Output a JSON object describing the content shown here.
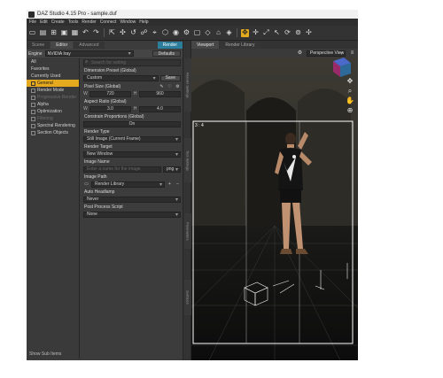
{
  "window": {
    "title": "DAZ Studio 4.15 Pro - sample.duf"
  },
  "menu": [
    "File",
    "Edit",
    "Create",
    "Tools",
    "Render",
    "Connect",
    "Window",
    "Help"
  ],
  "left_tabs": [
    {
      "label": "Scene",
      "active": false
    },
    {
      "label": "Editor",
      "active": true
    },
    {
      "label": "Advanced",
      "active": false
    },
    {
      "label": "Render",
      "active": false
    }
  ],
  "engine": {
    "label": "Engine",
    "value": "NVIDIA Iray",
    "defaults_label": "Defaults"
  },
  "categories": [
    {
      "label": "All"
    },
    {
      "label": "Favorites"
    },
    {
      "label": "Currently Used"
    },
    {
      "label": "General",
      "selected": true
    },
    {
      "label": "Render Mode"
    },
    {
      "label": "Progressive Render",
      "dim": true
    },
    {
      "label": "Alpha"
    },
    {
      "label": "Optimization"
    },
    {
      "label": "Filtering",
      "dim": true
    },
    {
      "label": "Spectral Rendering"
    },
    {
      "label": "Section Objects"
    }
  ],
  "show_sub_items": "Show Sub Items",
  "settings": {
    "search_placeholder": "Search for setting",
    "dimension_preset": {
      "title": "Dimension Preset (Global)",
      "value": "Custom",
      "save_label": "Save"
    },
    "pixel_size": {
      "title": "Pixel Size (Global)",
      "w_label": "W",
      "w": "720",
      "h_label": "H",
      "h": "960"
    },
    "aspect_ratio": {
      "title": "Aspect Ratio (Global)",
      "w_label": "W",
      "w": "3.0",
      "h_label": "H",
      "h": "4.0"
    },
    "constrain": {
      "title": "Constrain Proportions (Global)",
      "value": "On"
    },
    "render_type": {
      "title": "Render Type",
      "value": "Still Image (Current Frame)"
    },
    "render_target": {
      "title": "Render Target",
      "value": "New Window"
    },
    "image_name": {
      "title": "Image Name",
      "placeholder": "Enter a name for the image",
      "ext": "png"
    },
    "image_path": {
      "title": "Image Path",
      "value": "Render Library"
    },
    "auto_headlamp": {
      "title": "Auto Headlamp",
      "value": "Never"
    },
    "post_process": {
      "title": "Post Process Script",
      "value": "None"
    }
  },
  "side_tabs": [
    "Render Settings",
    "Tool Settings",
    "Parameters",
    "Surfaces"
  ],
  "viewport": {
    "tabs": [
      {
        "label": "Viewport",
        "active": true
      },
      {
        "label": "Render Library",
        "active": false
      }
    ],
    "camera": "Perspective View",
    "aspect_label": "3 : 4"
  },
  "colors": {
    "accent": "#e4a91d",
    "tab_accent": "#2c7d9c"
  }
}
